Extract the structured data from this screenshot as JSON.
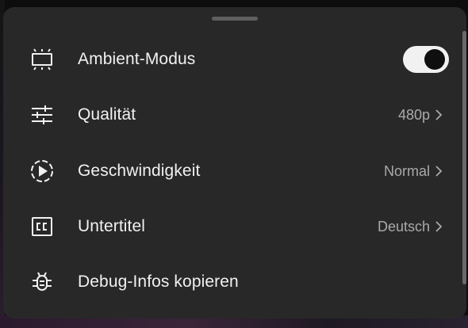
{
  "menu": {
    "items": [
      {
        "label": "Ambient-Modus",
        "icon": "ambient-mode-icon",
        "toggle_on": true
      },
      {
        "label": "Qualität",
        "value": "480p",
        "icon": "sliders-icon"
      },
      {
        "label": "Geschwindigkeit",
        "value": "Normal",
        "icon": "playback-speed-icon"
      },
      {
        "label": "Untertitel",
        "value": "Deutsch",
        "icon": "closed-captions-icon"
      },
      {
        "label": "Debug-Infos kopieren",
        "icon": "bug-icon"
      }
    ]
  },
  "colors": {
    "sheet_background": "#282828",
    "text_primary": "#f1f1f1",
    "text_secondary": "#aaaaaa",
    "toggle_track": "#f1f1f1",
    "toggle_knob": "#0f0f0f"
  }
}
